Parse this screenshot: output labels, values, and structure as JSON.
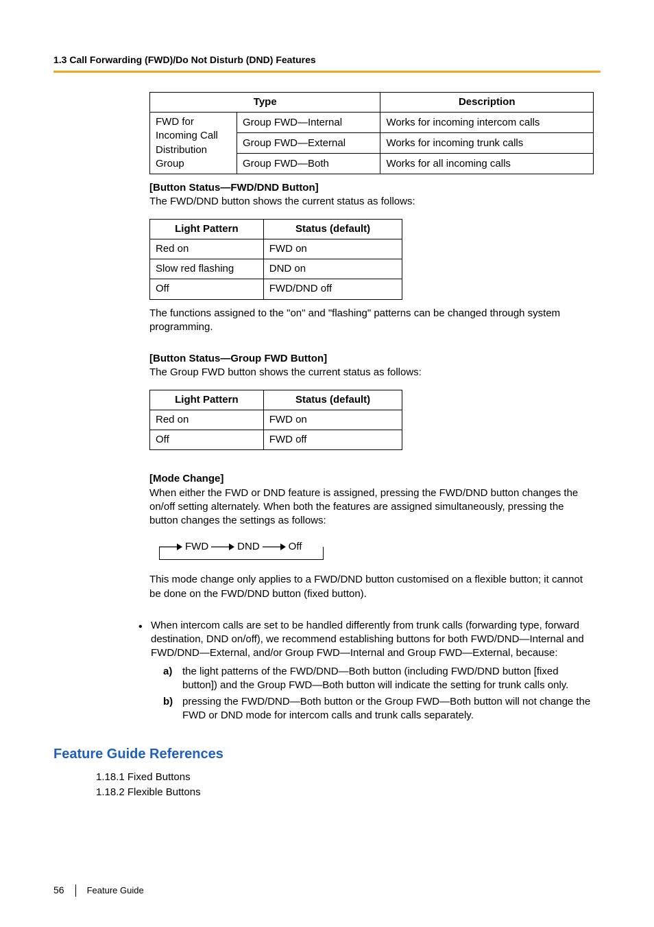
{
  "header": {
    "section_title": "1.3 Call Forwarding (FWD)/Do Not Disturb (DND) Features"
  },
  "table1": {
    "head": {
      "c1": "Type",
      "c2": "Description"
    },
    "rowspan_label": "FWD for Incoming Call Distribution Group",
    "rows": [
      {
        "type": "Group FWD—Internal",
        "desc": "Works for incoming intercom calls"
      },
      {
        "type": "Group FWD—External",
        "desc": "Works for incoming trunk calls"
      },
      {
        "type": "Group FWD—Both",
        "desc": "Works for all incoming calls"
      }
    ]
  },
  "block_fwd_dnd": {
    "title": "[Button Status—FWD/DND Button]",
    "intro": "The FWD/DND button shows the current status as follows:",
    "head": {
      "c1": "Light Pattern",
      "c2": "Status (default)"
    },
    "rows": [
      {
        "pat": "Red on",
        "stat": "FWD on"
      },
      {
        "pat": "Slow red flashing",
        "stat": "DND on"
      },
      {
        "pat": "Off",
        "stat": "FWD/DND off"
      }
    ],
    "footnote": "The functions assigned to the \"on\" and \"flashing\" patterns can be changed through system programming."
  },
  "block_group_fwd": {
    "title": "[Button Status—Group FWD Button]",
    "intro": "The Group FWD button shows the current status as follows:",
    "head": {
      "c1": "Light Pattern",
      "c2": "Status (default)"
    },
    "rows": [
      {
        "pat": "Red on",
        "stat": "FWD on"
      },
      {
        "pat": "Off",
        "stat": "FWD off"
      }
    ]
  },
  "mode_change": {
    "title": "[Mode Change]",
    "p1": "When either the FWD or DND feature is assigned, pressing the FWD/DND button changes the on/off setting alternately. When both the features are assigned simultaneously, pressing the button changes the settings as follows:",
    "steps": {
      "s1": "FWD",
      "s2": "DND",
      "s3": "Off"
    },
    "p2": "This mode change only applies to a FWD/DND button customised on a flexible button; it cannot be done on the FWD/DND button (fixed button)."
  },
  "bullet": {
    "p": "When intercom calls are set to be handled differently from trunk calls (forwarding type, forward destination, DND on/off), we recommend establishing buttons for both FWD/DND—Internal and FWD/DND—External, and/or Group FWD—Internal and Group FWD—External, because:",
    "a_label": "a)",
    "a_text": "the light patterns of the FWD/DND—Both button (including FWD/DND button [fixed button]) and the Group FWD—Both button will indicate the setting for trunk calls only.",
    "b_label": "b)",
    "b_text": "pressing the FWD/DND—Both button or the Group FWD—Both button will not change the FWD or DND mode for intercom calls and trunk calls separately."
  },
  "refs": {
    "heading": "Feature Guide References",
    "items": [
      "1.18.1 Fixed Buttons",
      "1.18.2 Flexible Buttons"
    ]
  },
  "footer": {
    "page": "56",
    "label": "Feature Guide"
  }
}
